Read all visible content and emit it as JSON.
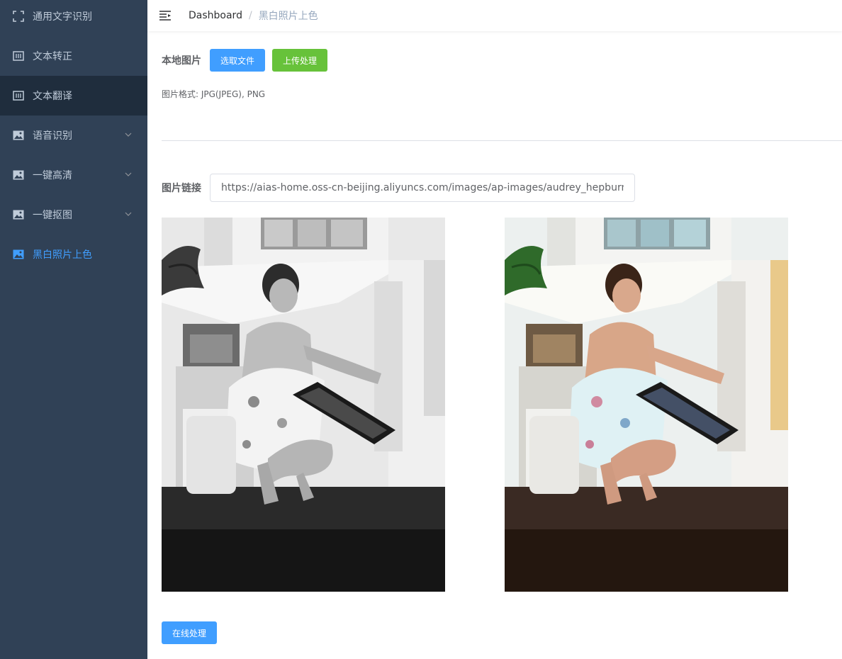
{
  "sidebar": {
    "items": [
      {
        "label": "通用文字识别",
        "icon": "scan-icon",
        "expandable": false
      },
      {
        "label": "文本转正",
        "icon": "text-box-icon",
        "expandable": false
      },
      {
        "label": "文本翻译",
        "icon": "text-box-icon",
        "expandable": false
      },
      {
        "label": "语音识别",
        "icon": "picture-icon",
        "expandable": true
      },
      {
        "label": "一键高清",
        "icon": "picture-icon",
        "expandable": true
      },
      {
        "label": "一键抠图",
        "icon": "picture-icon",
        "expandable": true
      },
      {
        "label": "黑白照片上色",
        "icon": "picture-icon",
        "expandable": false,
        "active": true
      }
    ],
    "background": "#304156",
    "active_color": "#409eff"
  },
  "navbar": {
    "breadcrumb": [
      "Dashboard",
      "黑白照片上色"
    ]
  },
  "upload": {
    "label": "本地图片",
    "select_button": "选取文件",
    "upload_button": "上传处理",
    "hint": "图片格式: JPG(JPEG), PNG"
  },
  "url_section": {
    "label": "图片链接",
    "value": "https://aias-home.oss-cn-beijing.aliyuncs.com/images/ap-images/audrey_hepburn.jpg"
  },
  "images": {
    "original": "grayscale-photo",
    "colorized": "colorized-photo"
  },
  "actions": {
    "online_button": "在线处理"
  },
  "colors": {
    "primary": "#409eff",
    "success": "#67c23a"
  }
}
